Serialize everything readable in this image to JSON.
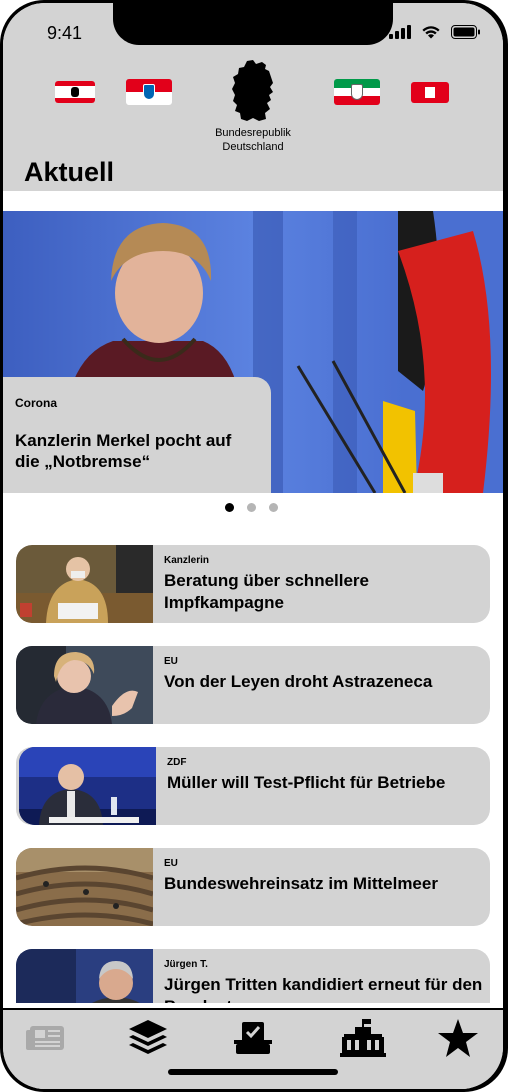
{
  "status_bar": {
    "time": "9:41"
  },
  "header": {
    "country_line1": "Bundesrepublik",
    "country_line2": "Deutschland",
    "title": "Aktuell",
    "states": [
      "Berlin",
      "Hessen",
      "Nordrhein-Westfalen",
      "Hamburg"
    ]
  },
  "hero": {
    "category": "Corona",
    "title": "Kanzlerin Merkel pocht auf die „Notbremse“",
    "page_count": 3,
    "active_page": 1
  },
  "news": [
    {
      "category": "Kanzlerin",
      "title": "Beratung über schnellere Impfkampagne"
    },
    {
      "category": "EU",
      "title": "Von der Leyen droht Astrazeneca"
    },
    {
      "category": "ZDF",
      "title": "Müller will Test-Pflicht für Betriebe"
    },
    {
      "category": "EU",
      "title": "Bundeswehreinsatz im Mittelmeer"
    },
    {
      "category": "Jürgen T.",
      "title": "Jürgen Tritten kandidiert erneut für den Bundestag"
    }
  ],
  "tabbar": {
    "tabs": [
      {
        "icon": "newspaper-icon",
        "active": false
      },
      {
        "icon": "layers-icon",
        "active": true
      },
      {
        "icon": "ballot-box-icon",
        "active": true
      },
      {
        "icon": "parliament-building-icon",
        "active": true
      },
      {
        "icon": "star-icon",
        "active": true
      }
    ]
  },
  "colors": {
    "panel": "#d3d3d3",
    "accent": "#000000",
    "inactive_tab": "#a9a9a9"
  }
}
